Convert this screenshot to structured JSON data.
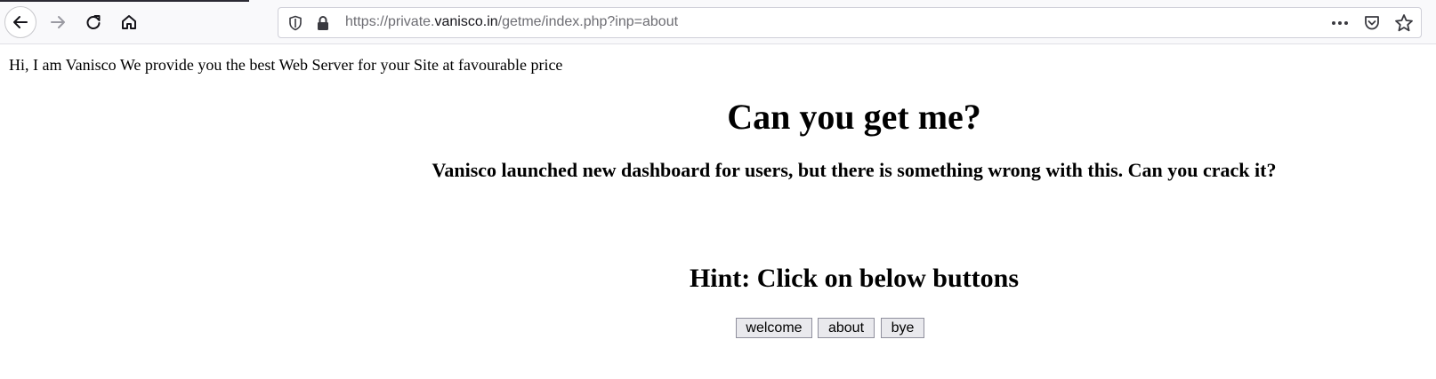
{
  "browser": {
    "url_prefix": "https://private.",
    "url_domain": "vanisco.in",
    "url_path": "/getme/index.php?inp=about",
    "icons": {
      "back": "arrow-left-icon",
      "forward": "arrow-right-icon",
      "reload": "reload-icon",
      "home": "home-icon",
      "shield": "shield-icon",
      "lock": "lock-icon",
      "more": "more-icon",
      "pocket": "pocket-icon",
      "bookmark": "star-icon"
    },
    "overflow_label": "•••"
  },
  "page": {
    "intro": "Hi, I am Vanisco We provide you the best Web Server for your Site at favourable price",
    "title": "Can you get me?",
    "subtitle": "Vanisco launched new dashboard for users, but there is something wrong with this. Can you crack it?",
    "hint": "Hint: Click on below buttons",
    "buttons": {
      "welcome": "welcome",
      "about": "about",
      "bye": "bye"
    }
  }
}
